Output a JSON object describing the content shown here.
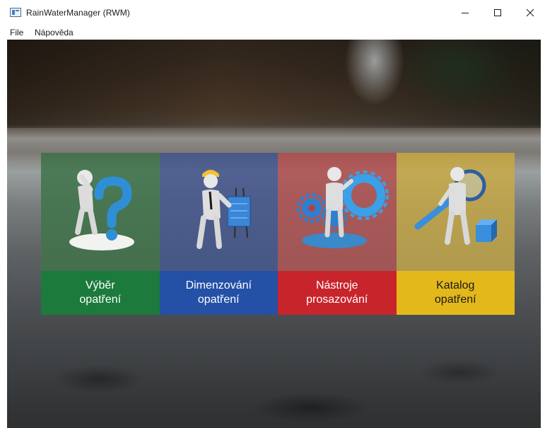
{
  "window": {
    "title": "RainWaterManager (RWM)",
    "controls": [
      "minimize",
      "maximize",
      "close"
    ]
  },
  "menu": {
    "items": [
      {
        "label": "File"
      },
      {
        "label": "Nápověda"
      }
    ]
  },
  "tiles": [
    {
      "label": "Výběr\nopatření",
      "icon": "question-figure-icon",
      "color": "#1c7a3c"
    },
    {
      "label": "Dimenzování\nopatření",
      "icon": "engineer-figure-icon",
      "color": "#2450a6"
    },
    {
      "label": "Nástroje\nprosazování",
      "icon": "gears-figure-icon",
      "color": "#c8242b"
    },
    {
      "label": "Katalog\nopatření",
      "icon": "magnifier-figure-icon",
      "color": "#e3b81a"
    }
  ]
}
